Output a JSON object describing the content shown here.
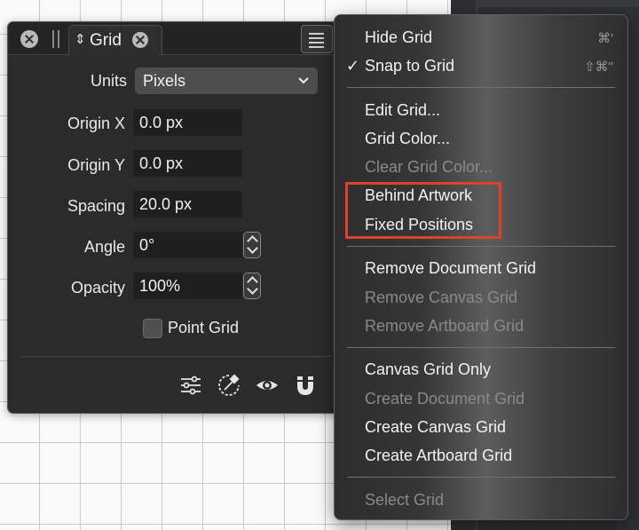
{
  "panel": {
    "tab_title": "Grid",
    "units_label": "Units",
    "units_value": "Pixels",
    "fields": [
      {
        "label": "Origin X",
        "value": "0.0 px"
      },
      {
        "label": "Origin Y",
        "value": "0.0 px"
      },
      {
        "label": "Spacing",
        "value": "20.0 px"
      },
      {
        "label": "Angle",
        "value": "0°"
      },
      {
        "label": "Opacity",
        "value": "100%"
      }
    ],
    "point_grid_label": "Point Grid",
    "icons": [
      "sliders-icon",
      "color-picker-icon",
      "eye-icon",
      "magnet-icon"
    ]
  },
  "menu": {
    "items": [
      {
        "label": "Hide Grid",
        "shortcut": "⌘'",
        "enabled": true
      },
      {
        "label": "Snap to Grid",
        "shortcut": "⇧⌘\"",
        "enabled": true,
        "checked": true
      },
      {
        "label": "Edit Grid...",
        "enabled": true
      },
      {
        "label": "Grid Color...",
        "enabled": true
      },
      {
        "label": "Clear Grid Color...",
        "enabled": false
      },
      {
        "label": "Behind Artwork",
        "enabled": true
      },
      {
        "label": "Fixed Positions",
        "enabled": true
      },
      {
        "label": "Remove Document Grid",
        "enabled": true
      },
      {
        "label": "Remove Canvas Grid",
        "enabled": false
      },
      {
        "label": "Remove Artboard Grid",
        "enabled": false
      },
      {
        "label": "Canvas Grid Only",
        "enabled": true
      },
      {
        "label": "Create Document Grid",
        "enabled": false
      },
      {
        "label": "Create Canvas Grid",
        "enabled": true
      },
      {
        "label": "Create Artboard Grid",
        "enabled": true
      },
      {
        "label": "Select Grid",
        "enabled": false
      }
    ],
    "check_mark": "✓"
  },
  "colors": {
    "highlight_box": "#e0412f",
    "panel_bg": "#2b2b2b",
    "disabled_text": "#8a8a8a"
  }
}
